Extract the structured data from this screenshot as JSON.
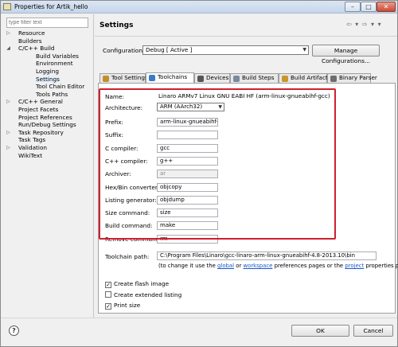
{
  "window": {
    "title": "Properties for Artik_hello",
    "min": "–",
    "max": "□",
    "close": "✕"
  },
  "filter": {
    "placeholder": "type filter text"
  },
  "tree": [
    {
      "label": "Resource",
      "arrow": "▷"
    },
    {
      "label": "Builders",
      "arrow": ""
    },
    {
      "label": "C/C++ Build",
      "arrow": "◢"
    },
    {
      "label": "Build Variables",
      "arrow": ""
    },
    {
      "label": "Environment",
      "arrow": ""
    },
    {
      "label": "Logging",
      "arrow": ""
    },
    {
      "label": "Settings",
      "arrow": ""
    },
    {
      "label": "Tool Chain Editor",
      "arrow": ""
    },
    {
      "label": "Tools Paths",
      "arrow": ""
    },
    {
      "label": "C/C++ General",
      "arrow": "▷"
    },
    {
      "label": "Project Facets",
      "arrow": ""
    },
    {
      "label": "Project References",
      "arrow": ""
    },
    {
      "label": "Run/Debug Settings",
      "arrow": ""
    },
    {
      "label": "Task Repository",
      "arrow": "▷"
    },
    {
      "label": "Task Tags",
      "arrow": ""
    },
    {
      "label": "Validation",
      "arrow": "▷"
    },
    {
      "label": "WikiText",
      "arrow": ""
    }
  ],
  "header": {
    "title": "Settings",
    "nav": "⇦ ▾ ⇨ ▾ ▾"
  },
  "configuration": {
    "label": "Configuration:",
    "value": "Debug  [ Active ]",
    "manage": "Manage Configurations..."
  },
  "tabs": [
    {
      "label": "Tool Settings",
      "color": "#c0902f"
    },
    {
      "label": "Toolchains",
      "color": "#3a7bc8"
    },
    {
      "label": "Devices",
      "color": "#555555"
    },
    {
      "label": "Build Steps",
      "color": "#7a8a9a"
    },
    {
      "label": "Build Artifact",
      "color": "#c8962a"
    },
    {
      "label": "Binary Parser",
      "color": "#6d6d6d"
    }
  ],
  "form": {
    "name_label": "Name:",
    "name_value": "Linaro ARMv7 Linux GNU EABI HF (arm-linux-gnueabihf-gcc)",
    "arch_label": "Architecture:",
    "arch_value": "ARM (AArch32)",
    "fields": [
      {
        "label": "Prefix:",
        "value": "arm-linux-gnueabihf-",
        "disabled": false
      },
      {
        "label": "Suffix:",
        "value": "",
        "disabled": false
      },
      {
        "label": "C compiler:",
        "value": "gcc",
        "disabled": false
      },
      {
        "label": "C++ compiler:",
        "value": "g++",
        "disabled": false
      },
      {
        "label": "Archiver:",
        "value": "ar",
        "disabled": true
      },
      {
        "label": "Hex/Bin converter:",
        "value": "objcopy",
        "disabled": false
      },
      {
        "label": "Listing generator:",
        "value": "objdump",
        "disabled": false
      },
      {
        "label": "Size command:",
        "value": "size",
        "disabled": false
      },
      {
        "label": "Build command:",
        "value": "make",
        "disabled": false
      },
      {
        "label": "Remove command:",
        "value": "rm",
        "disabled": false
      }
    ]
  },
  "toolchain": {
    "label": "Toolchain path:",
    "value": "C:\\Program Files\\Linaro\\gcc-linaro-arm-linux-gnueabihf-4.8-2013.10\\bin",
    "note_pre": "(to change it use the ",
    "link_global": "global",
    "note_or": " or ",
    "link_workspace": "workspace",
    "note_mid": " preferences pages or the ",
    "link_project": "project",
    "note_post": " properties pa"
  },
  "checkboxes": [
    {
      "label": "Create flash image",
      "checked": true
    },
    {
      "label": "Create extended listing",
      "checked": false
    },
    {
      "label": "Print size",
      "checked": true
    }
  ],
  "buttons": {
    "ok": "OK",
    "cancel": "Cancel",
    "help": "?"
  },
  "colors": {
    "highlight": "#d11f2e",
    "link": "#1a55c9",
    "titlebar": "#c5d5ea"
  }
}
